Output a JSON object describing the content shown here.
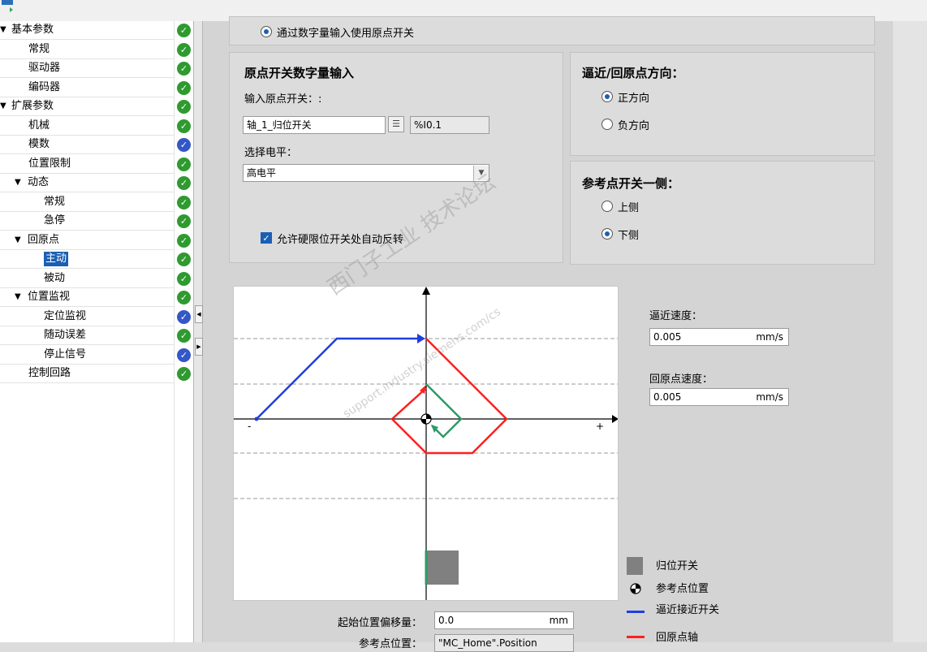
{
  "tree": {
    "items": [
      {
        "label": "基本参数",
        "level": 0,
        "expanded": true,
        "status": "green"
      },
      {
        "label": "常规",
        "level": 1,
        "status": "green"
      },
      {
        "label": "驱动器",
        "level": 1,
        "status": "green"
      },
      {
        "label": "编码器",
        "level": 1,
        "status": "green"
      },
      {
        "label": "扩展参数",
        "level": 0,
        "expanded": true,
        "status": "green"
      },
      {
        "label": "机械",
        "level": 1,
        "status": "green"
      },
      {
        "label": "模数",
        "level": 1,
        "status": "blue"
      },
      {
        "label": "位置限制",
        "level": 1,
        "status": "green"
      },
      {
        "label": "动态",
        "level": 1,
        "expanded": true,
        "status": "green"
      },
      {
        "label": "常规",
        "level": 2,
        "status": "green"
      },
      {
        "label": "急停",
        "level": 2,
        "status": "green"
      },
      {
        "label": "回原点",
        "level": 1,
        "expanded": true,
        "status": "green"
      },
      {
        "label": "主动",
        "level": 2,
        "status": "green",
        "selected": true
      },
      {
        "label": "被动",
        "level": 2,
        "status": "green"
      },
      {
        "label": "位置监视",
        "level": 1,
        "expanded": true,
        "status": "green"
      },
      {
        "label": "定位监视",
        "level": 2,
        "status": "blue"
      },
      {
        "label": "随动误差",
        "level": 2,
        "status": "green"
      },
      {
        "label": "停止信号",
        "level": 2,
        "status": "blue"
      },
      {
        "label": "控制回路",
        "level": 1,
        "status": "green"
      }
    ]
  },
  "top_option": {
    "label": "通过数字量输入使用原点开关",
    "selected": true
  },
  "switch_panel": {
    "title": "原点开关数字量输入",
    "input_label": "输入原点开关：:",
    "input_value": "轴_1_归位开关",
    "address": "%I0.1",
    "level_label": "选择电平：",
    "level_value": "高电平",
    "auto_reverse_label": "允许硬限位开关处自动反转",
    "auto_reverse_checked": true
  },
  "direction_panel": {
    "title": "逼近/回原点方向：",
    "options": [
      {
        "label": "正方向",
        "selected": true
      },
      {
        "label": "负方向",
        "selected": false
      }
    ]
  },
  "side_panel": {
    "title": "参考点开关一侧：",
    "options": [
      {
        "label": "上侧",
        "selected": false
      },
      {
        "label": "下侧",
        "selected": true
      }
    ]
  },
  "diagram": {
    "minus_label": "-",
    "plus_label": "+",
    "colors": {
      "approach": "#1f3fe0",
      "homing": "#ff2020",
      "switch_edge": "#2e9a68",
      "switch_box": "#808080"
    }
  },
  "speeds": {
    "approach_label": "逼近速度：",
    "approach_value": "0.005",
    "homing_label": "回原点速度：",
    "homing_value": "0.005",
    "unit": "mm/s"
  },
  "legend": {
    "switch": "归位开关",
    "ref_point": "参考点位置",
    "approach": "逼近接近开关",
    "homing": "回原点轴"
  },
  "bottom": {
    "offset_label": "起始位置偏移量：",
    "offset_value": "0.0",
    "offset_unit": "mm",
    "refpos_label": "参考点位置：",
    "refpos_value": "\"MC_Home\".Position"
  },
  "watermark": {
    "line1": "西门子工业 技术论坛",
    "line2": "support.industry.siemens.com/cs"
  }
}
